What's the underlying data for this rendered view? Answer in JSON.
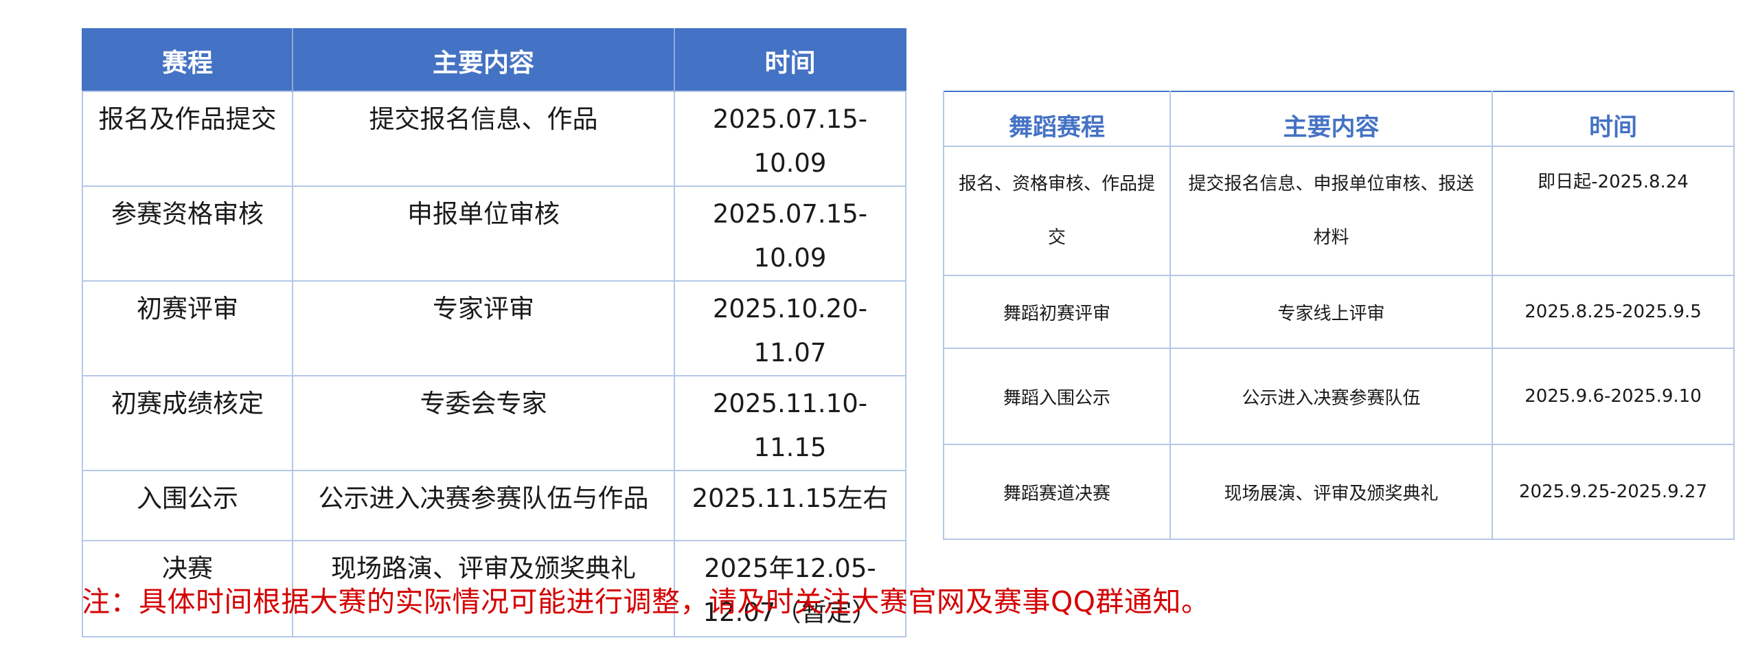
{
  "schedule_table": {
    "headers": [
      "赛程",
      "主要内容",
      "时间"
    ],
    "rows": [
      [
        "报名及作品提交",
        "提交报名信息、作品",
        "2025.07.15-10.09"
      ],
      [
        "参赛资格审核",
        "申报单位审核",
        "2025.07.15-10.09"
      ],
      [
        "初赛评审",
        "专家评审",
        "2025.10.20-11.07"
      ],
      [
        "初赛成绩核定",
        "专委会专家",
        "2025.11.10-11.15"
      ],
      [
        "入围公示",
        "公示进入决赛参赛队伍与作品",
        "2025.11.15左右"
      ],
      [
        "决赛",
        "现场路演、评审及颁奖典礼",
        "2025年12.05-12.07（暂定）"
      ]
    ]
  },
  "dance_table": {
    "headers": [
      "舞蹈赛程",
      "主要内容",
      "时间"
    ],
    "rows": [
      [
        "报名、资格审核、作品提交",
        "提交报名信息、申报单位审核、报送材料",
        "即日起-2025.8.24"
      ],
      [
        "舞蹈初赛评审",
        "专家线上评审",
        "2025.8.25-2025.9.5"
      ],
      [
        "舞蹈入围公示",
        "公示进入决赛参赛队伍",
        "2025.9.6-2025.9.10"
      ],
      [
        "舞蹈赛道决赛",
        "现场展演、评审及颁奖典礼",
        "2025.9.25-2025.9.27"
      ]
    ]
  },
  "footnote": "注：具体时间根据大赛的实际情况可能进行调整，请及时关注大赛官网及赛事QQ群通知。",
  "colors": {
    "header_blue": "#4472c4",
    "grid_light_blue": "#b4c7e7",
    "note_red": "#d40000"
  }
}
